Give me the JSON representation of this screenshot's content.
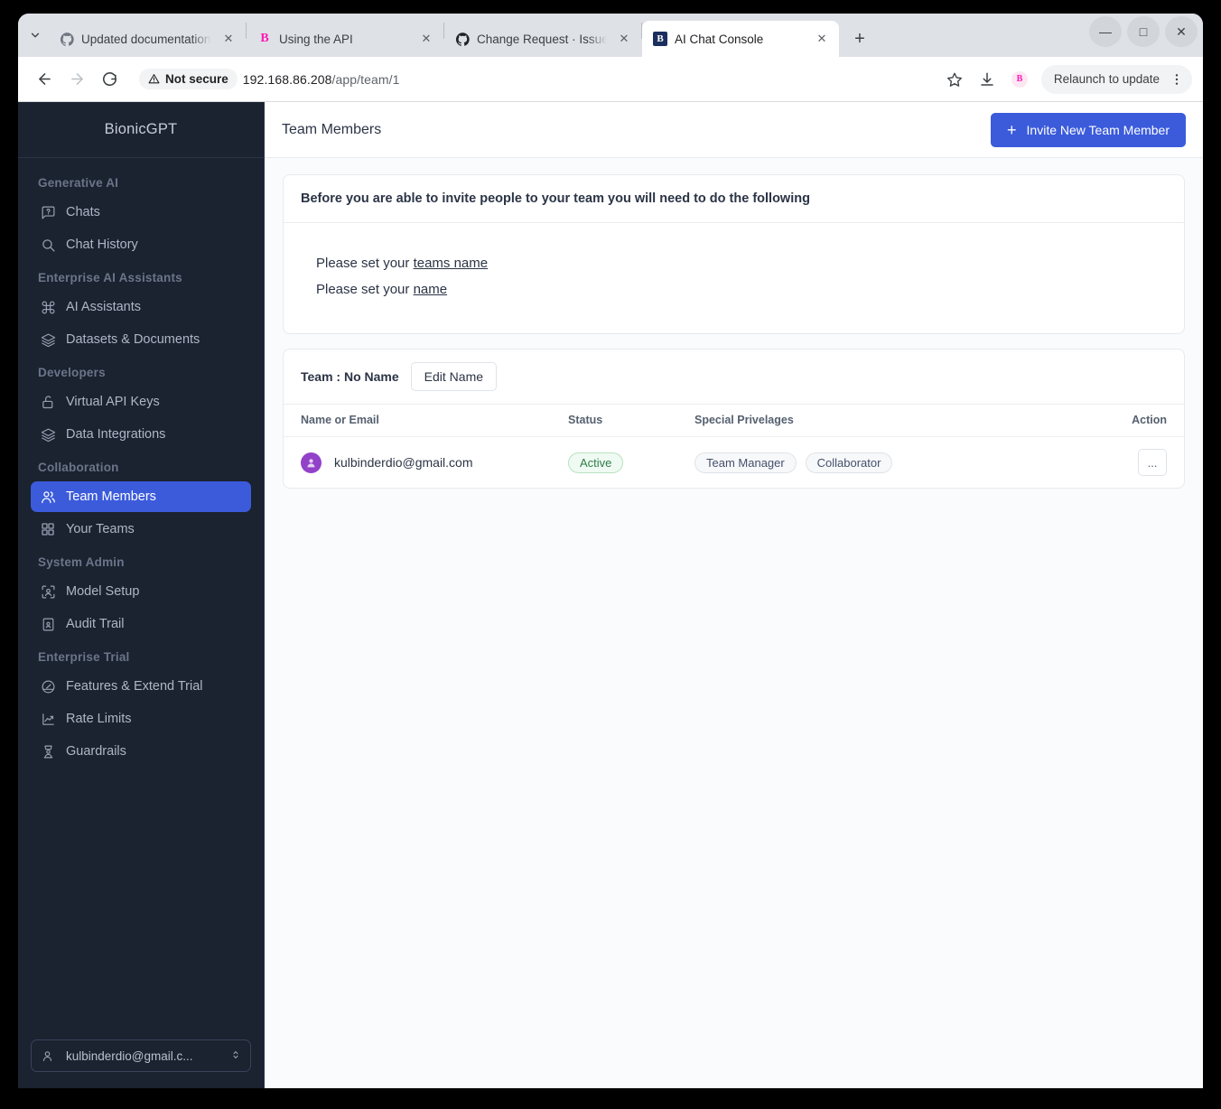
{
  "browser": {
    "tabs": [
      {
        "title": "Updated documentation",
        "favicon": "github-icon",
        "active": false
      },
      {
        "title": "Using the API",
        "favicon": "bionicgpt-icon",
        "active": false
      },
      {
        "title": "Change Request · Issue #",
        "favicon": "github-icon",
        "active": false
      },
      {
        "title": "AI Chat Console",
        "favicon": "bionicgpt-square-icon",
        "active": true
      }
    ],
    "new_tab_label": "+",
    "window_controls": {
      "minimize": "—",
      "maximize": "□",
      "close": "✕"
    },
    "security_label": "Not secure",
    "url_host": "192.168.86.208",
    "url_path": "/app/team/1",
    "relaunch_label": "Relaunch to update",
    "extension_badge": "B",
    "icons": {
      "back": "back-arrow-icon",
      "forward": "forward-arrow-icon",
      "reload": "reload-icon",
      "bookmark": "star-icon",
      "download": "download-icon",
      "menu": "kebab-menu-icon",
      "tab_list": "chevron-down-icon"
    }
  },
  "sidebar": {
    "brand": "BionicGPT",
    "groups": [
      {
        "label": "Generative AI",
        "items": [
          {
            "label": "Chats",
            "icon": "chat-question-icon",
            "active": false
          },
          {
            "label": "Chat History",
            "icon": "search-icon",
            "active": false
          }
        ]
      },
      {
        "label": "Enterprise AI Assistants",
        "items": [
          {
            "label": "AI Assistants",
            "icon": "command-icon",
            "active": false
          },
          {
            "label": "Datasets & Documents",
            "icon": "layers-icon",
            "active": false
          }
        ]
      },
      {
        "label": "Developers",
        "items": [
          {
            "label": "Virtual API Keys",
            "icon": "unlock-icon",
            "active": false
          },
          {
            "label": "Data Integrations",
            "icon": "layers-icon",
            "active": false
          }
        ]
      },
      {
        "label": "Collaboration",
        "items": [
          {
            "label": "Team Members",
            "icon": "users-icon",
            "active": true
          },
          {
            "label": "Your Teams",
            "icon": "grid-icon",
            "active": false
          }
        ]
      },
      {
        "label": "System Admin",
        "items": [
          {
            "label": "Model Setup",
            "icon": "user-scan-icon",
            "active": false
          },
          {
            "label": "Audit Trail",
            "icon": "clipboard-user-icon",
            "active": false
          }
        ]
      },
      {
        "label": "Enterprise Trial",
        "items": [
          {
            "label": "Features & Extend Trial",
            "icon": "gauge-icon",
            "active": false
          },
          {
            "label": "Rate Limits",
            "icon": "chart-line-icon",
            "active": false
          },
          {
            "label": "Guardrails",
            "icon": "shield-person-icon",
            "active": false
          }
        ]
      }
    ],
    "footer": {
      "user_label": "kulbinderdio@gmail.c...",
      "icon": "person-icon",
      "caret": "updown-caret-icon"
    }
  },
  "main": {
    "page_title": "Team Members",
    "invite_button": "Invite New Team Member",
    "invite_icon": "plus-icon",
    "notice": {
      "heading": "Before you are able to invite people to your team you will need to do the following",
      "requirements": [
        {
          "prefix": "Please set your ",
          "link": "teams name"
        },
        {
          "prefix": "Please set your ",
          "link": "name"
        }
      ]
    },
    "team": {
      "label": "Team : No Name",
      "edit_button": "Edit Name"
    },
    "table": {
      "columns": [
        "Name or Email",
        "Status",
        "Special Privelages",
        "Action"
      ],
      "rows": [
        {
          "name": "kulbinderdio@gmail.com",
          "avatar_color": "#9242c9",
          "status": "Active",
          "privileges": [
            "Team Manager",
            "Collaborator"
          ],
          "action": "..."
        }
      ]
    }
  },
  "colors": {
    "accent": "#3b5bdb",
    "sidebar_bg": "#1b2230",
    "status_active_text": "#2f7d4a",
    "status_active_bg": "#effaf2"
  }
}
